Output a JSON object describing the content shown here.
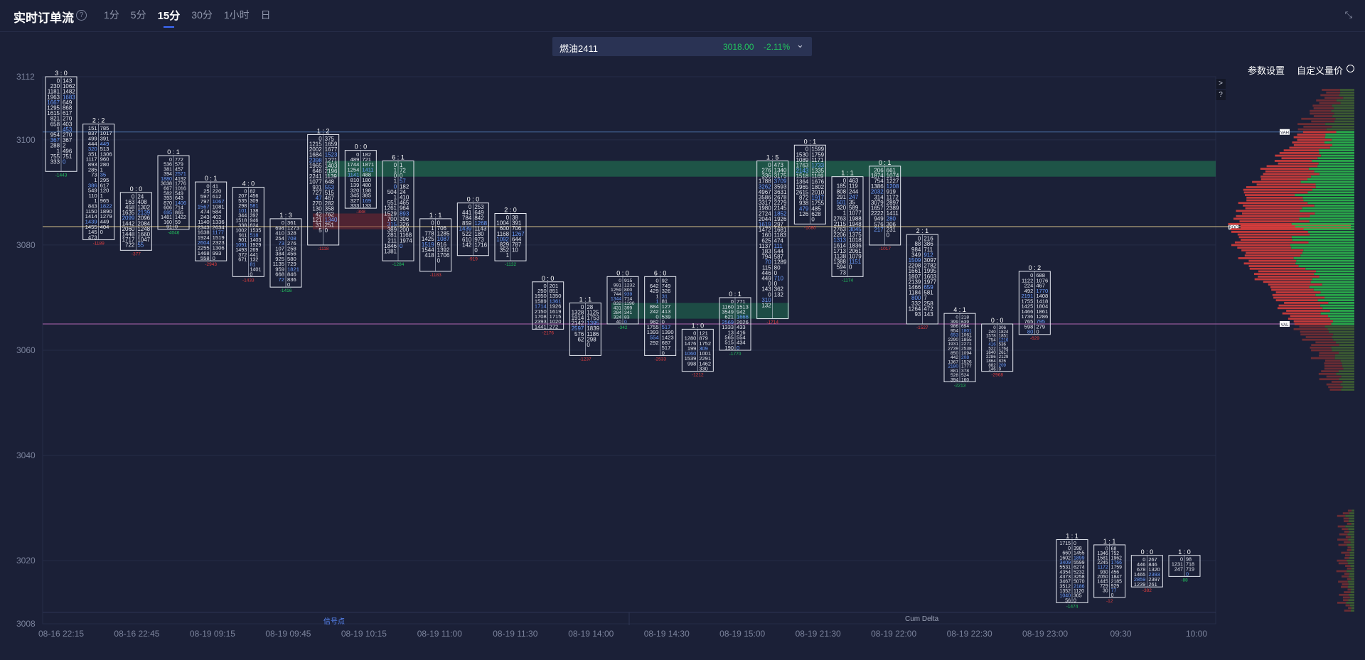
{
  "header": {
    "title": "实时订单流",
    "help_icon": "?",
    "tabs": [
      "1分",
      "5分",
      "15分",
      "30分",
      "1小时",
      "日"
    ],
    "active_tab": "15分"
  },
  "symbol": {
    "name": "燃油2411",
    "price": "3018.00",
    "change": "-2.11%"
  },
  "toolbar": {
    "settings_label": "参数设置",
    "custom_label": "自定义量价"
  },
  "side_buttons": [
    ">",
    "?"
  ],
  "footer": {
    "left_label": "信号点",
    "right_label": "Cum Delta"
  },
  "markers": {
    "vah": "VAH",
    "poc": "POC",
    "val": "VAL"
  },
  "colors": {
    "background": "#1b2037",
    "buy": "#22c55e",
    "sell": "#e53e3e",
    "vah_line": "#4a6fa5",
    "poc_line": "#d4c08a",
    "val_line": "#b066b0"
  },
  "chart_data": {
    "type": "footprint",
    "ylim": [
      3008,
      3112
    ],
    "y_ticks": [
      "3112",
      "3100",
      "3080",
      "3060",
      "3040",
      "3020",
      "3008"
    ],
    "x_ticks": [
      "08-16 22:15",
      "08-16 22:45",
      "08-19 09:15",
      "08-19 09:45",
      "08-19 10:15",
      "08-19 11:00",
      "08-19 11:30",
      "08-19 14:00",
      "08-19 14:30",
      "08-19 15:00",
      "08-19 21:30",
      "08-19 22:00",
      "08-19 22:30",
      "08-19 23:00",
      "09:30",
      "10:00"
    ],
    "levels": {
      "vah": 3101.5,
      "poc": 3083.5,
      "val": 3065
    },
    "bars": [
      {
        "top": 3112,
        "bottom": 3094,
        "head": "3 : 0",
        "bid": [
          "0",
          "230",
          "1181",
          "1963",
          "1667",
          "1295",
          "1615",
          "821",
          "658",
          "1",
          "954",
          "367",
          "288",
          "1",
          "755",
          "333"
        ],
        "ask": [
          "143",
          "1062",
          "1482",
          "1683",
          "649",
          "868",
          "617",
          "270",
          "403",
          "453",
          "270",
          "367",
          "2",
          "496",
          "751",
          "0"
        ],
        "delta": "-1443"
      },
      {
        "top": 3103,
        "bottom": 3081,
        "head": "2 : 2",
        "bid": [
          "151",
          "837",
          "499",
          "444",
          "320",
          "351",
          "1117",
          "893",
          "285",
          "73",
          "1",
          "386",
          "549",
          "110",
          "1",
          "843",
          "1150",
          "1414",
          "1439",
          "1455",
          "145",
          "473"
        ],
        "ask": [
          "785",
          "1017",
          "391",
          "449",
          "513",
          "1306",
          "960",
          "280",
          "1",
          "35",
          "295",
          "617",
          "120",
          "1",
          "965",
          "1822",
          "1890",
          "1279",
          "449",
          "404",
          "0"
        ],
        "delta": "-1189"
      },
      {
        "top": 3090,
        "bottom": 3079,
        "head": "0 : 0",
        "bid": [
          "0",
          "163",
          "458",
          "1635",
          "2099",
          "1442",
          "2060",
          "1448",
          "1717",
          "722"
        ],
        "ask": [
          "24",
          "408",
          "1302",
          "2139",
          "2096",
          "2084",
          "1248",
          "1660",
          "1047",
          "55"
        ],
        "delta": "-377"
      },
      {
        "top": 3097,
        "bottom": 3083,
        "head": "0 : 1",
        "bid": [
          "0",
          "536",
          "381",
          "394",
          "1880",
          "3038",
          "667",
          "582",
          "393",
          "870",
          "606",
          "695",
          "1481",
          "160",
          "91"
        ],
        "ask": [
          "772",
          "579",
          "457",
          "2571",
          "4192",
          "1776",
          "1016",
          "549",
          "643",
          "1406",
          "714",
          "865",
          "1422",
          "59",
          "0"
        ],
        "delta": "-4046"
      },
      {
        "top": 3092,
        "bottom": 3077,
        "head": "0 : 1",
        "bid": [
          "0",
          "25",
          "597",
          "797",
          "1567",
          "474",
          "243",
          "1140",
          "2343",
          "1638",
          "1924",
          "2604",
          "2255",
          "1468",
          "558"
        ],
        "ask": [
          "41",
          "220",
          "612",
          "1067",
          "1081",
          "584",
          "402",
          "1336",
          "2634",
          "1177",
          "1519",
          "2323",
          "1306",
          "993",
          "0"
        ],
        "delta": "-2943"
      },
      {
        "top": 3091,
        "bottom": 3074,
        "head": "4 : 0",
        "bid": [
          "0",
          "207",
          "535",
          "298",
          "101",
          "344",
          "1518",
          "338",
          "1002",
          "911",
          "901",
          "1091",
          "1493",
          "372",
          "671"
        ],
        "ask": [
          "82",
          "456",
          "309",
          "581",
          "138",
          "392",
          "946",
          "624",
          "1535",
          "518",
          "1403",
          "1929",
          "269",
          "441",
          "132",
          "81",
          "1401",
          "0"
        ],
        "delta": "-1433"
      },
      {
        "top": 3085,
        "bottom": 3072,
        "head": "1 : 3",
        "bid": [
          "0",
          "694",
          "410",
          "254",
          "73",
          "107",
          "384",
          "925",
          "1135",
          "959",
          "668",
          "72"
        ],
        "ask": [
          "361",
          "1273",
          "328",
          "708",
          "276",
          "258",
          "456",
          "580",
          "729",
          "1821",
          "846",
          "836",
          "0"
        ],
        "delta": "-1416"
      },
      {
        "top": 3101,
        "bottom": 3080,
        "head": "1 : 2",
        "bid": [
          "0",
          "1215",
          "2002",
          "1684",
          "2398",
          "1965",
          "646",
          "2241",
          "1077",
          "931",
          "727",
          "47",
          "270",
          "130",
          "42",
          "121",
          "31",
          "5"
        ],
        "ask": [
          "375",
          "1659",
          "1677",
          "1523",
          "1271",
          "1403",
          "2196",
          "1139",
          "648",
          "553",
          "515",
          "467",
          "282",
          "358",
          "762",
          "1340",
          "251",
          "0"
        ],
        "delta": "-1118"
      },
      {
        "top": 3098,
        "bottom": 3087,
        "head": "0 : 0",
        "bid": [
          "0",
          "489",
          "1744",
          "1254",
          "1141",
          "810",
          "139",
          "320",
          "345",
          "327",
          "333"
        ],
        "ask": [
          "182",
          "721",
          "1871",
          "1411",
          "488",
          "180",
          "480",
          "198",
          "385",
          "169",
          "133"
        ],
        "delta": "-388"
      },
      {
        "top": 3096,
        "bottom": 3077,
        "head": "6 : 1",
        "bid": [
          "0",
          "1",
          "0",
          "1",
          "0",
          "504",
          "1",
          "551",
          "1261",
          "1529",
          "700",
          "315",
          "389",
          "281",
          "211",
          "1846",
          "1381"
        ],
        "ask": [
          "1",
          "72",
          "0",
          "57",
          "182",
          "24",
          "410",
          "465",
          "964",
          "893",
          "306",
          "326",
          "200",
          "1168",
          "1974",
          "0"
        ],
        "delta": "-1284"
      },
      {
        "top": 3085,
        "bottom": 3075,
        "head": "1 : 1",
        "bid": [
          "0",
          "1",
          "778",
          "1425",
          "1519",
          "1544",
          "418"
        ],
        "ask": [
          "0",
          "706",
          "1285",
          "1087",
          "916",
          "1392",
          "1706",
          "0"
        ],
        "delta": "-1183"
      },
      {
        "top": 3088,
        "bottom": 3078,
        "head": "0 : 0",
        "bid": [
          "0",
          "441",
          "784",
          "859",
          "1439",
          "522",
          "610",
          "142"
        ],
        "ask": [
          "253",
          "649",
          "842",
          "1268",
          "1143",
          "180",
          "973",
          "1716",
          "0"
        ],
        "delta": "-919"
      },
      {
        "top": 3086,
        "bottom": 3077,
        "head": "2 : 0",
        "bid": [
          "0",
          "1004",
          "600",
          "1168",
          "1092",
          "829",
          "352",
          "1"
        ],
        "ask": [
          "38",
          "391",
          "706",
          "1267",
          "644",
          "787",
          "10"
        ],
        "delta": "-1132"
      },
      {
        "top": 3073,
        "bottom": 3064,
        "head": "0 : 0",
        "bid": [
          "0",
          "250",
          "1950",
          "1589",
          "1714",
          "2150",
          "1708",
          "2393",
          "1441"
        ],
        "ask": [
          "201",
          "851",
          "1350",
          "1361",
          "1926",
          "1619",
          "1715",
          "1020",
          "272"
        ],
        "delta": "-2176"
      },
      {
        "top": 3069,
        "bottom": 3059,
        "head": "1 : 1",
        "bid": [
          "0",
          "1328",
          "1914",
          "2142",
          "2597",
          "576",
          "62"
        ],
        "ask": [
          "28",
          "1125",
          "1753",
          "1395",
          "1839",
          "1186",
          "298",
          "0"
        ],
        "delta": "-1237"
      },
      {
        "top": 3074,
        "bottom": 3065,
        "head": "0 : 0",
        "bid": [
          "0",
          "991",
          "1259",
          "744",
          "1344",
          "832",
          "431",
          "284",
          "324",
          "40"
        ],
        "ask": [
          "915",
          "1232",
          "800",
          "939",
          "714",
          "1190",
          "399",
          "341",
          "83",
          "0"
        ],
        "delta": "-342"
      },
      {
        "top": 3074,
        "bottom": 3059,
        "head": "6 : 0",
        "bid": [
          "0",
          "642",
          "429",
          "1",
          "1",
          "884",
          "242",
          "0",
          "982",
          "1755",
          "1393",
          "554",
          "292"
        ],
        "ask": [
          "92",
          "749",
          "326",
          "31",
          "81",
          "127",
          "413",
          "539",
          "0",
          "517",
          "1390",
          "1423",
          "687",
          "517",
          "0"
        ],
        "delta": "-2533"
      },
      {
        "top": 3064,
        "bottom": 3056,
        "head": "1 : 0",
        "bid": [
          "0",
          "1280",
          "1476",
          "199",
          "1060",
          "1539",
          "998"
        ],
        "ask": [
          "121",
          "879",
          "1752",
          "309",
          "1001",
          "2291",
          "1462",
          "330"
        ],
        "delta": "-1212"
      },
      {
        "top": 3070,
        "bottom": 3060,
        "head": "0 : 1",
        "bid": [
          "0",
          "1160",
          "3549",
          "621",
          "2569",
          "1333",
          "13",
          "565",
          "515",
          "190"
        ],
        "ask": [
          "771",
          "1513",
          "942",
          "1666",
          "2026",
          "433",
          "416",
          "554",
          "434",
          "0"
        ],
        "delta": "-1770"
      },
      {
        "top": 3096,
        "bottom": 3066,
        "head": "1 : 5",
        "bid": [
          "0",
          "276",
          "336",
          "1788",
          "3262",
          "4967",
          "3586",
          "3317",
          "1980",
          "2724",
          "2044",
          "1619",
          "1472",
          "160",
          "625",
          "1137",
          "183",
          "794",
          "70",
          "115",
          "446",
          "449",
          "0",
          "143",
          "0",
          "310",
          "132"
        ],
        "ask": [
          "473",
          "1340",
          "3175",
          "3709",
          "3593",
          "3631",
          "2678",
          "2279",
          "2145",
          "1852",
          "1926",
          "297",
          "1681",
          "1183",
          "474",
          "111",
          "544",
          "587",
          "1289",
          "80",
          "0",
          "710",
          "0",
          "362",
          "132"
        ],
        "delta": "-1714"
      },
      {
        "top": 3099,
        "bottom": 3084,
        "head": "0 : 1",
        "bid": [
          "0",
          "1530",
          "1089",
          "1763",
          "2143",
          "1518",
          "1364",
          "1965",
          "2615",
          "872",
          "938",
          "479",
          "126"
        ],
        "ask": [
          "1599",
          "1759",
          "1171",
          "1733",
          "1335",
          "1169",
          "1676",
          "1802",
          "2010",
          "1917",
          "1755",
          "485",
          "628",
          "0"
        ],
        "delta": "-1080"
      },
      {
        "top": 3093,
        "bottom": 3074,
        "head": "1 : 1",
        "bid": [
          "0",
          "185",
          "808",
          "291",
          "501",
          "320",
          "1",
          "2763",
          "2115",
          "2763",
          "2206",
          "1313",
          "1614",
          "1713",
          "1138",
          "1388",
          "594",
          "73"
        ],
        "ask": [
          "463",
          "119",
          "244",
          "247",
          "35",
          "589",
          "1077",
          "1988",
          "1948",
          "3045",
          "1375",
          "1018",
          "1836",
          "2061",
          "1079",
          "1151",
          "0"
        ],
        "delta": "-1174"
      },
      {
        "top": 3095,
        "bottom": 3080,
        "head": "0 : 1",
        "bid": [
          "206",
          "1874",
          "754",
          "1386",
          "2032",
          "314",
          "3079",
          "1657",
          "2222",
          "949",
          "576",
          "217"
        ],
        "ask": [
          "661",
          "1074",
          "1227",
          "1208",
          "919",
          "1172",
          "2897",
          "2389",
          "1411",
          "280",
          "306",
          "231",
          "0"
        ],
        "delta": "-1017"
      },
      {
        "top": 3082,
        "bottom": 3065,
        "head": "2 : 1",
        "bid": [
          "0",
          "88",
          "984",
          "349",
          "1509",
          "2208",
          "1661",
          "1807",
          "2139",
          "1466",
          "1184",
          "800",
          "332",
          "1264",
          "93"
        ],
        "ask": [
          "216",
          "386",
          "711",
          "912",
          "3097",
          "2782",
          "1995",
          "1603",
          "1977",
          "659",
          "581",
          "7",
          "258",
          "472",
          "143"
        ],
        "delta": "-1527"
      },
      {
        "top": 3067,
        "bottom": 3054,
        "head": "4 : 1",
        "bid": [
          "0",
          "399",
          "986",
          "954",
          "653",
          "2290",
          "1931",
          "2739",
          "850",
          "442",
          "1367",
          "2180",
          "881",
          "528",
          "394"
        ],
        "ask": [
          "218",
          "639",
          "694",
          "1801",
          "1061",
          "1855",
          "2271",
          "2538",
          "1094",
          "208",
          "1526",
          "1777",
          "378",
          "524",
          "160"
        ],
        "delta": "-2213"
      },
      {
        "top": 3065,
        "bottom": 3056,
        "head": "0 : 0",
        "bid": [
          "0",
          "240",
          "1578",
          "754",
          "416",
          "522",
          "1640",
          "2286",
          "1864",
          "882",
          "146"
        ],
        "ask": [
          "306",
          "1824",
          "1851",
          "1216",
          "536",
          "1764",
          "2617",
          "2129",
          "826",
          "209",
          "0"
        ],
        "delta": "-2968"
      },
      {
        "top": 3075,
        "bottom": 3063,
        "head": "0 : 2",
        "bid": [
          "0",
          "1122",
          "224",
          "492",
          "2191",
          "1755",
          "1425",
          "1466",
          "1736",
          "765",
          "598",
          "80"
        ],
        "ask": [
          "688",
          "1076",
          "467",
          "1770",
          "1408",
          "1418",
          "1804",
          "1861",
          "1286",
          "795",
          "279",
          "0"
        ],
        "delta": "-629"
      },
      {
        "top": 3024,
        "bottom": 3012,
        "head": "1 : 1",
        "bid": [
          "1715",
          "0",
          "660",
          "1602",
          "3409",
          "5531",
          "4354",
          "4373",
          "3467",
          "3512",
          "1352",
          "1040",
          "56"
        ],
        "ask": [
          "0",
          "398",
          "1455",
          "1899",
          "5599",
          "6274",
          "5232",
          "3258",
          "5070",
          "2186",
          "1120",
          "305",
          "0"
        ],
        "delta": "-1474"
      },
      {
        "top": 3023,
        "bottom": 3013,
        "head": "1 : 1",
        "bid": [
          "0",
          "1346",
          "1581",
          "2245",
          "1172",
          "930",
          "2050",
          "1445",
          "729",
          "30"
        ],
        "ask": [
          "68",
          "752",
          "1962",
          "1766",
          "1759",
          "456",
          "1847",
          "2185",
          "929",
          "77",
          "0"
        ],
        "delta": "-12"
      },
      {
        "top": 3021,
        "bottom": 3015,
        "head": "0 : 0",
        "bid": [
          "0",
          "446",
          "678",
          "1465",
          "2859",
          "1239"
        ],
        "ask": [
          "267",
          "846",
          "1320",
          "2393",
          "2397",
          "261"
        ],
        "delta": "-382"
      },
      {
        "top": 3021,
        "bottom": 3017,
        "head": "1 : 0",
        "bid": [
          "0",
          "1231",
          "247"
        ],
        "ask": [
          "98",
          "718",
          "719",
          "0"
        ],
        "delta": "-88"
      }
    ]
  }
}
